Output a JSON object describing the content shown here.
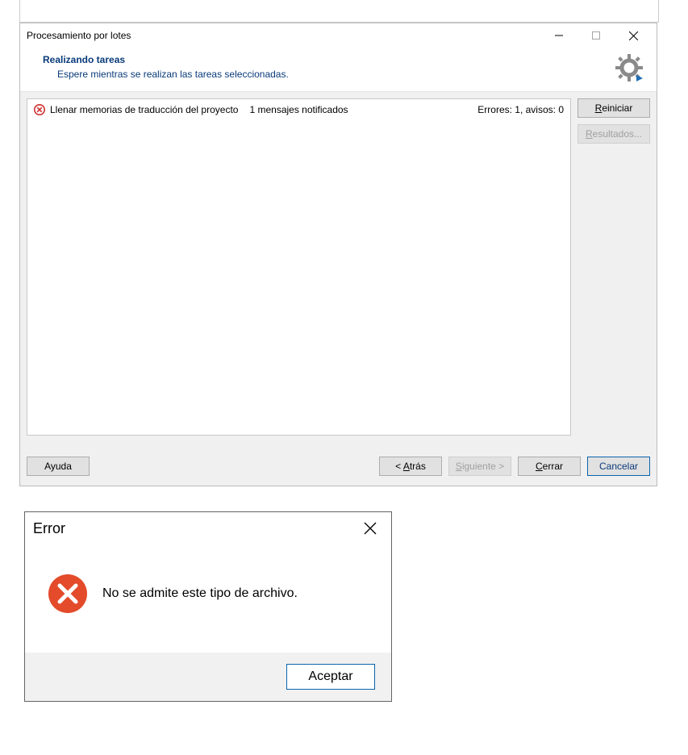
{
  "batch_window": {
    "title": "Procesamiento por lotes",
    "heading": "Realizando tareas",
    "subheading": "Espere mientras se realizan las tareas seleccionadas.",
    "task": {
      "name": "Llenar memorias de traducción del proyecto",
      "msg": "1 mensajes notificados",
      "counts": "Errores: 1, avisos: 0"
    },
    "side": {
      "restart": "Reiniciar",
      "restart_ul": "R",
      "results": "Resultados...",
      "results_ul": "R"
    },
    "footer": {
      "help": "Ayuda",
      "back_prefix": "< ",
      "back_text": "Atrás",
      "back_ul": "A",
      "next_text": "Siguiente >",
      "next_ul": "S",
      "close_text": "Cerrar",
      "close_ul": "C",
      "cancel": "Cancelar"
    }
  },
  "error_dialog": {
    "title": "Error",
    "message": "No se admite este tipo de archivo.",
    "ok": "Aceptar"
  }
}
